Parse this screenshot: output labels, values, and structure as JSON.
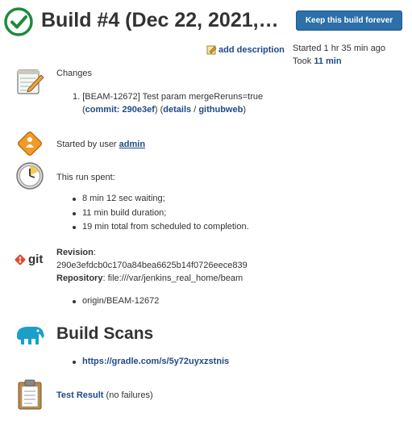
{
  "header": {
    "title": "Build #4 (Dec 22, 2021,…",
    "keep_button": "Keep this build forever",
    "add_description": "add description",
    "started_text": "Started 1 hr 35 min ago",
    "took_prefix": "Took",
    "took_value": "11 min"
  },
  "changes": {
    "heading": "Changes",
    "item_number": "1.",
    "item_text": "[BEAM-12672] Test param mergeReruns=true",
    "open_paren": "(",
    "commit_label": "commit: 290e3ef",
    "close_paren_details": ") (",
    "details_label": "details",
    "separator": " / ",
    "githubweb_label": "githubweb",
    "close_paren": ")"
  },
  "started_by": {
    "prefix": "Started by user",
    "user": "admin"
  },
  "timing": {
    "heading": "This run spent:",
    "items": [
      "8 min 12 sec waiting;",
      "11 min build duration;",
      "19 min total from scheduled to completion."
    ]
  },
  "git": {
    "logo_text": "git",
    "revision_label": "Revision",
    "revision_colon": ":",
    "revision_value": "290e3efdcb0c170a84bea6625b14f0726eece839",
    "repository_label": "Repository",
    "repository_value": ": file:///var/jenkins_real_home/beam",
    "branches": [
      "origin/BEAM-12672"
    ]
  },
  "build_scans": {
    "heading": "Build Scans",
    "links": [
      "https://gradle.com/s/5y72uyxzstnis"
    ]
  },
  "test_result": {
    "link": "Test Result",
    "suffix": " (no failures)"
  },
  "colors": {
    "success_green": "#1d8a3b",
    "link_blue": "#204a87",
    "button_blue": "#2d6fa8"
  }
}
